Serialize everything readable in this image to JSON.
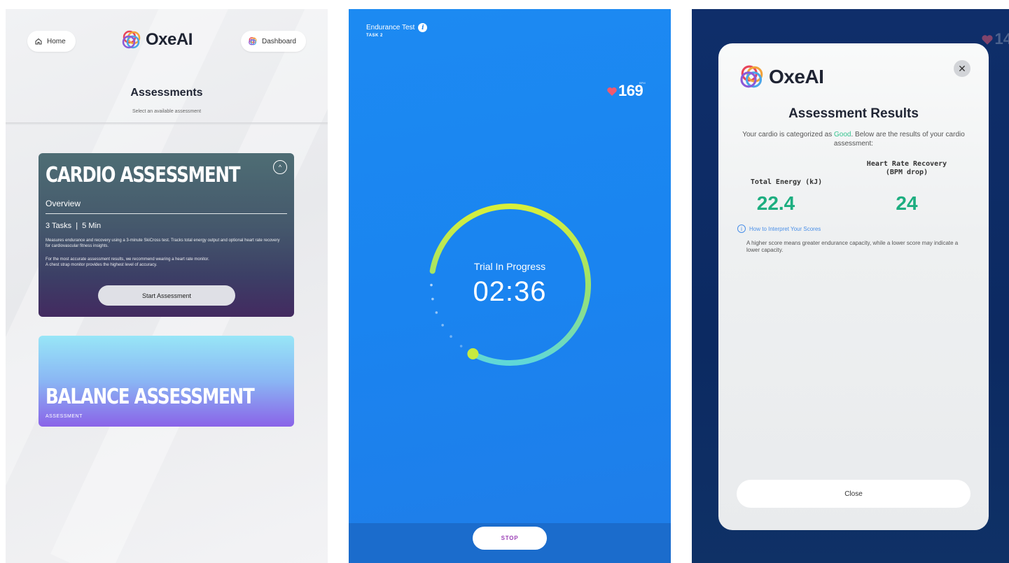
{
  "assessments_screen": {
    "home_label": "Home",
    "brand": "OxeAI",
    "dashboard_label": "Dashboard",
    "title": "Assessments",
    "subtitle": "Select an available assessment",
    "cardio": {
      "title": "CARDIO ASSESSMENT",
      "overview": "Overview",
      "meta": "3 Tasks  |  5 Min",
      "desc1": "Measures endurance and recovery using a 3-minute SkiCross test. Tracks total energy output and optional heart rate recovery for cardiovascular fitness insights.",
      "desc2": "For the most accurate assessment results, we recommend wearing a heart rate monitor.",
      "desc3": "A chest strap monitor provides the highest level of accuracy.",
      "start_label": "Start Assessment"
    },
    "balance": {
      "title": "BALANCE ASSESSMENT",
      "subtitle": "ASSESSMENT"
    }
  },
  "trial_screen": {
    "title": "Endurance Test",
    "task": "TASK 2",
    "bpm_label": "BPM",
    "heart_rate": "169",
    "status": "Trial In Progress",
    "timer": "02:36",
    "progress": 0.8,
    "stop_label": "STOP"
  },
  "results_screen": {
    "background_reading": "14",
    "brand": "OxeAI",
    "title": "Assessment Results",
    "desc_prefix": "Your cardio is categorized as ",
    "category": "Good",
    "desc_suffix": ". Below are the results of your cardio assessment:",
    "col1_label": "Total Energy (kJ)",
    "col1_value": "22.4",
    "col2_label_line1": "Heart Rate Recovery",
    "col2_label_line2": "(BPM drop)",
    "col2_value": "24",
    "interpret_link": "How to Interpret Your Scores",
    "interpret_text": "A higher score means greater endurance capacity, while a lower score may indicate a lower capacity.",
    "close_label": "Close"
  },
  "colors": {
    "accent_green": "#1dae80",
    "trial_blue": "#1a84f0",
    "stop_purple": "#9b3fb6",
    "link_blue": "#4a8fe8"
  }
}
